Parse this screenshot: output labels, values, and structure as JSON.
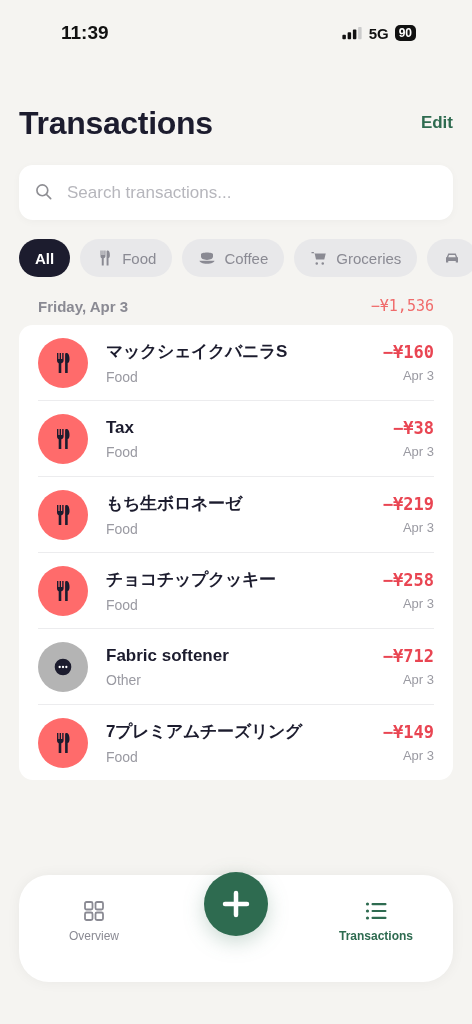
{
  "status_bar": {
    "time": "11:39",
    "network": "5G",
    "battery": "90"
  },
  "header": {
    "title": "Transactions",
    "action": "Edit"
  },
  "search": {
    "placeholder": "Search transactions..."
  },
  "filters": [
    {
      "kind": "all",
      "label": "All",
      "selected": true
    },
    {
      "kind": "food",
      "label": "Food",
      "selected": false
    },
    {
      "kind": "coffee",
      "label": "Coffee",
      "selected": false
    },
    {
      "kind": "groceries",
      "label": "Groceries",
      "selected": false
    },
    {
      "kind": "car",
      "selected": false
    }
  ],
  "groups": [
    {
      "date": "Friday, Apr 3",
      "total": "−¥1,536",
      "transactions": [
        {
          "kind": "food",
          "color": "#ff6b6b",
          "name": "マックシェイクバニラS",
          "category": "Food",
          "amount": "−¥160",
          "date": "Apr 3"
        },
        {
          "kind": "food",
          "color": "#ff6b6b",
          "name": "Tax",
          "category": "Food",
          "amount": "−¥38",
          "date": "Apr 3"
        },
        {
          "kind": "food",
          "color": "#ff6b6b",
          "name": "もち生ボロネーゼ",
          "category": "Food",
          "amount": "−¥219",
          "date": "Apr 3"
        },
        {
          "kind": "food",
          "color": "#ff6b6b",
          "name": "チョコチップクッキー",
          "category": "Food",
          "amount": "−¥258",
          "date": "Apr 3"
        },
        {
          "kind": "other",
          "color": "#b4b4b4",
          "name": "Fabric softener",
          "category": "Other",
          "amount": "−¥712",
          "date": "Apr 3"
        },
        {
          "kind": "food",
          "color": "#ff6b6b",
          "name": "7プレミアムチーズリング",
          "category": "Food",
          "amount": "−¥149",
          "date": "Apr 3"
        }
      ]
    }
  ],
  "tab_bar": {
    "tabs": [
      {
        "kind": "overview",
        "label": "Overview",
        "selected": false
      },
      {
        "kind": "list",
        "label": "Transactions",
        "selected": true
      }
    ]
  }
}
